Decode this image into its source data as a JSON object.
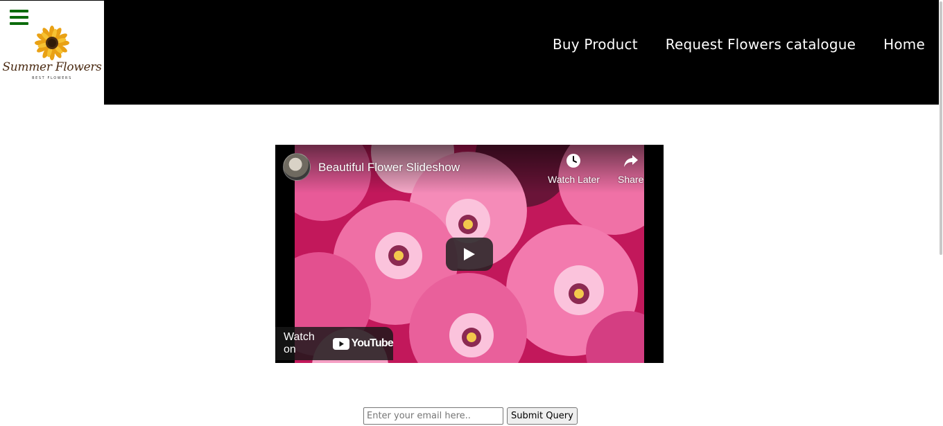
{
  "brand": {
    "name": "Summer Flowers",
    "tagline": "BEST FLOWERS",
    "menu_icon": "hamburger-menu-icon",
    "logo_icon": "sunflower-icon"
  },
  "nav": {
    "items": [
      {
        "label": "Buy Product"
      },
      {
        "label": "Request Flowers catalogue"
      },
      {
        "label": "Home"
      }
    ]
  },
  "video": {
    "title": "Beautiful Flower Slideshow",
    "watch_later_label": "Watch Later",
    "share_label": "Share",
    "watch_on_label": "Watch on",
    "youtube_word": "YouTube"
  },
  "newsletter": {
    "email_placeholder": "Enter your email here..",
    "email_value": "",
    "submit_label": "Submit Query"
  },
  "colors": {
    "navbar_bg": "#000000",
    "nav_text": "#ffffff",
    "menu_icon": "#0b6b0b",
    "brand_text": "#4a2a12",
    "youtube_red": "#ff0000"
  }
}
